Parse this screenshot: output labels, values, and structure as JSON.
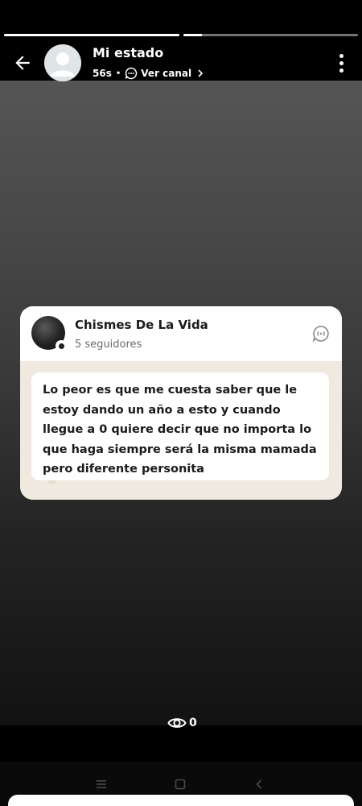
{
  "status": {
    "progress_segments": [
      1.0,
      0.11
    ]
  },
  "header": {
    "title": "Mi estado",
    "time": "56s",
    "separator": "•",
    "channel_link": "Ver canal",
    "back_icon": "arrow-left-icon",
    "menu_icon": "more-vertical-icon"
  },
  "channel_card": {
    "name": "Chismes De La Vida",
    "followers": "5 seguidores",
    "icon": "channel-icon",
    "message": "Lo peor es que me cuesta saber que le estoy dando un año a esto y cuando llegue a 0 quiere decir que no importa lo que haga siempre será la misma mamada pero diferente personita"
  },
  "footer": {
    "views": "0",
    "views_icon": "eye-icon"
  },
  "colors": {
    "card_bg": "#ffffff",
    "chat_bg": "#efe9df",
    "text": "#1b1b1b",
    "muted": "#6b6b6b"
  }
}
